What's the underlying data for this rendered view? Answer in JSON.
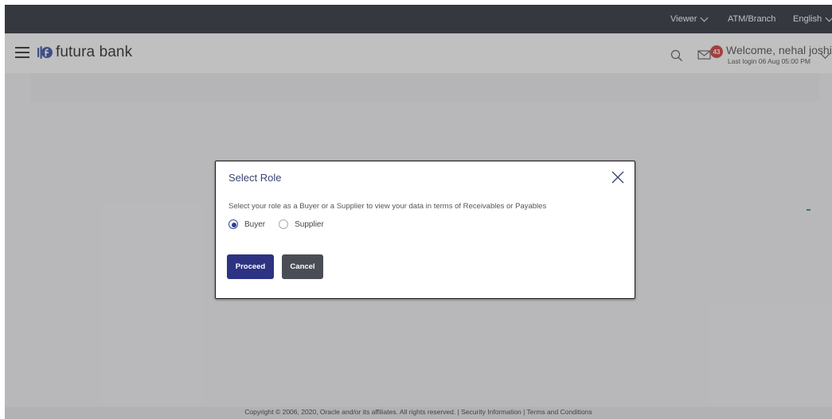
{
  "topbar": {
    "viewer": "Viewer",
    "atm_branch": "ATM/Branch",
    "language": "English"
  },
  "header": {
    "brand": "futura bank",
    "notification_count": "43",
    "welcome": "Welcome, nehal joshi",
    "last_login": "Last login 06 Aug 05:00 PM"
  },
  "modal": {
    "title": "Select Role",
    "description": "Select your role as a Buyer or a Supplier to view your data in terms of Receivables or Payables",
    "options": [
      {
        "label": "Buyer",
        "selected": true
      },
      {
        "label": "Supplier",
        "selected": false
      }
    ],
    "proceed_label": "Proceed",
    "cancel_label": "Cancel"
  },
  "footer": {
    "text": "Copyright © 2006, 2020, Oracle and/or its affiliates. All rights reserved. | Security Information | Terms and Conditions"
  },
  "colors": {
    "topbar": "#1f2430",
    "primary": "#2d3382",
    "secondary_button": "#4a4d55",
    "badge": "#d23030",
    "logo_accent": "#2f4aa0"
  },
  "icons": [
    "menu-icon",
    "futura-logo-icon",
    "search-icon",
    "mail-icon",
    "chevron-down-icon",
    "close-icon"
  ]
}
